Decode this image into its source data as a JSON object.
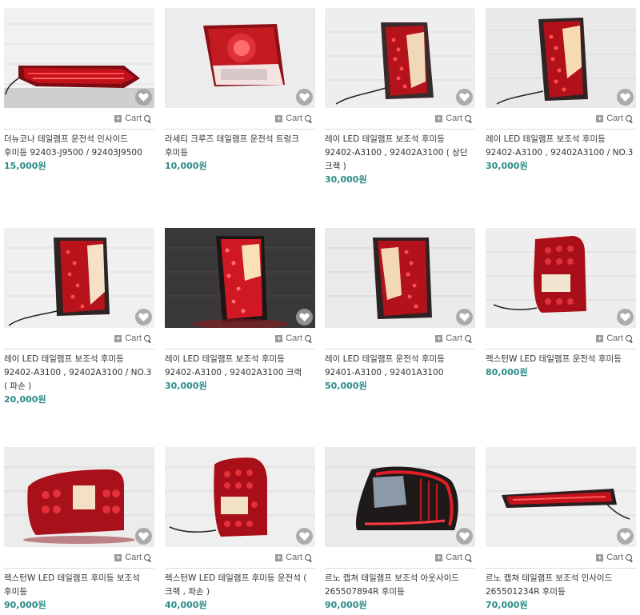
{
  "cart_label": "Cart",
  "rows": [
    [
      {
        "name": "더뉴코나 테일램프 운전석 인사이드 후미등 92403-J9500 / 92403J9500",
        "price": "15,000원"
      },
      {
        "name": "라세티 크루즈 테일램프 운전석 트렁크 후미등",
        "price": "10,000원"
      },
      {
        "name": "레이 LED 테일램프 보조석 후미등 92402-A3100 , 92402A3100 ( 상단 크랙 )",
        "price": "30,000원"
      },
      {
        "name": "레이 LED 테일램프 보조석 후미등 92402-A3100 , 92402A3100 / NO.3",
        "price": "30,000원"
      }
    ],
    [
      {
        "name": "레이 LED 테일램프 보조석 후미등 92402-A3100 , 92402A3100 / NO.3 ( 파손 )",
        "price": "20,000원"
      },
      {
        "name": "레이 LED 테일램프 보조석 후미등 92402-A3100 , 92402A3100 크랙",
        "price": "30,000원"
      },
      {
        "name": "레이 LED 테일램프 운전석 후미등 92401-A3100 , 92401A3100",
        "price": "50,000원"
      },
      {
        "name": "렉스턴W LED 테일램프 운전석 후미등",
        "price": "80,000원"
      }
    ],
    [
      {
        "name": "렉스턴W LED 테일램프 후미등 보조석 후미등",
        "price": "90,000원"
      },
      {
        "name": "렉스턴W LED 테일램프 후미등 운전석 ( 크랙 , 파손 )",
        "price": "40,000원"
      },
      {
        "name": "르노 캡쳐 테일램프 보조석 아웃사이드 265507894R 후미등",
        "price": "90,000원"
      },
      {
        "name": "르노 캡쳐 테일램프 보조석 인사이드 265501234R 후미등",
        "price": "70,000원"
      }
    ]
  ],
  "colors": {
    "price": "#2a8c86",
    "lamp_red": "#c4121c",
    "rule": "#dcdcdc"
  }
}
